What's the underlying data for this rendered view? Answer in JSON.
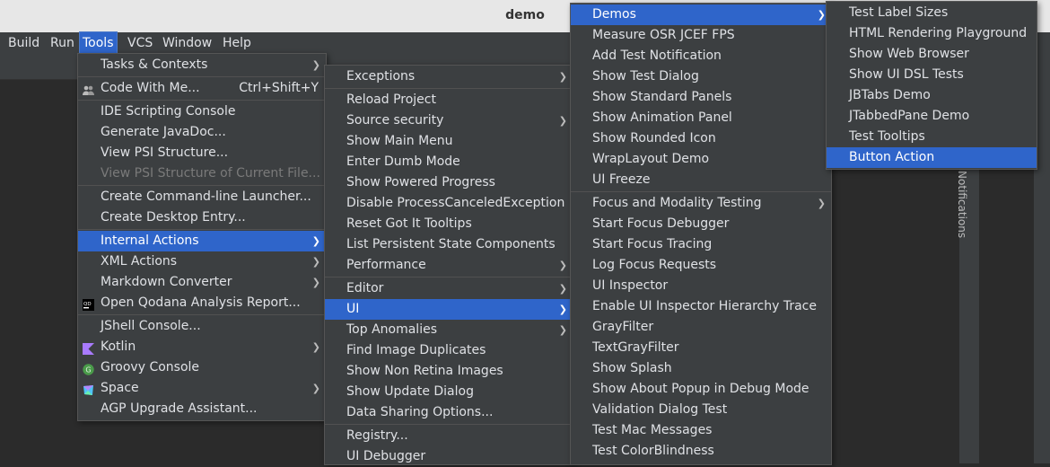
{
  "window": {
    "title": "demo"
  },
  "menubar": [
    "Build",
    "Run",
    "Tools",
    "VCS",
    "Window",
    "Help"
  ],
  "tools_menu": [
    {
      "label": "Tasks & Contexts",
      "sub": true
    },
    {
      "label": "Code With Me...",
      "shortcut": "Ctrl+Shift+Y",
      "icon": "people-icon"
    },
    {
      "label": "IDE Scripting Console"
    },
    {
      "label": "Generate JavaDoc..."
    },
    {
      "label": "View PSI Structure..."
    },
    {
      "label": "View PSI Structure of Current File...",
      "disabled": true
    },
    {
      "label": "Create Command-line Launcher..."
    },
    {
      "label": "Create Desktop Entry..."
    },
    {
      "label": "Internal Actions",
      "sub": true,
      "selected": true
    },
    {
      "label": "XML Actions",
      "sub": true
    },
    {
      "label": "Markdown Converter",
      "sub": true
    },
    {
      "label": "Open Qodana Analysis Report...",
      "icon": "qodana-icon"
    },
    {
      "label": "JShell Console..."
    },
    {
      "label": "Kotlin",
      "sub": true,
      "icon": "kotlin-icon"
    },
    {
      "label": "Groovy Console",
      "icon": "groovy-icon"
    },
    {
      "label": "Space",
      "sub": true,
      "icon": "space-icon"
    },
    {
      "label": "AGP Upgrade Assistant..."
    }
  ],
  "internal_menu": [
    {
      "label": "Exceptions",
      "sub": true
    },
    {
      "label": "Reload Project"
    },
    {
      "label": "Source security",
      "sub": true
    },
    {
      "label": "Show Main Menu"
    },
    {
      "label": "Enter Dumb Mode"
    },
    {
      "label": "Show Powered Progress"
    },
    {
      "label": "Disable ProcessCanceledException"
    },
    {
      "label": "Reset Got It Tooltips"
    },
    {
      "label": "List Persistent State Components"
    },
    {
      "label": "Performance",
      "sub": true
    },
    {
      "label": "Editor",
      "sub": true
    },
    {
      "label": "UI",
      "sub": true,
      "selected": true
    },
    {
      "label": "Top Anomalies",
      "sub": true
    },
    {
      "label": "Find Image Duplicates"
    },
    {
      "label": "Show Non Retina Images"
    },
    {
      "label": "Show Update Dialog"
    },
    {
      "label": "Data Sharing Options..."
    },
    {
      "label": "Registry..."
    },
    {
      "label": "UI Debugger"
    }
  ],
  "ui_menu": [
    {
      "label": "Demos",
      "sub": true,
      "selected": true
    },
    {
      "label": "Measure OSR JCEF FPS"
    },
    {
      "label": "Add Test Notification"
    },
    {
      "label": "Show Test Dialog"
    },
    {
      "label": "Show Standard Panels"
    },
    {
      "label": "Show Animation Panel"
    },
    {
      "label": "Show Rounded Icon"
    },
    {
      "label": "WrapLayout Demo"
    },
    {
      "label": "UI Freeze"
    },
    {
      "label": "Focus and Modality Testing",
      "sub": true
    },
    {
      "label": "Start Focus Debugger"
    },
    {
      "label": "Start Focus Tracing"
    },
    {
      "label": "Log Focus Requests"
    },
    {
      "label": "UI Inspector"
    },
    {
      "label": "Enable UI Inspector Hierarchy Trace"
    },
    {
      "label": "GrayFilter"
    },
    {
      "label": "TextGrayFilter"
    },
    {
      "label": "Show Splash"
    },
    {
      "label": "Show About Popup in Debug Mode"
    },
    {
      "label": "Validation Dialog Test"
    },
    {
      "label": "Test Mac Messages"
    },
    {
      "label": "Test ColorBlindness"
    }
  ],
  "demos_menu": [
    {
      "label": "Test Label Sizes"
    },
    {
      "label": "HTML Rendering Playground"
    },
    {
      "label": "Show Web Browser"
    },
    {
      "label": "Show UI DSL Tests"
    },
    {
      "label": "JBTabs Demo"
    },
    {
      "label": "JTabbedPane Demo"
    },
    {
      "label": "Test Tooltips"
    },
    {
      "label": "Button Action",
      "selected": true
    }
  ],
  "notifications_label": "Notifications",
  "colors": {
    "selection": "#2f65ca",
    "menu_bg": "#3c3f41",
    "titlebar_bg": "#e7e7e7"
  }
}
